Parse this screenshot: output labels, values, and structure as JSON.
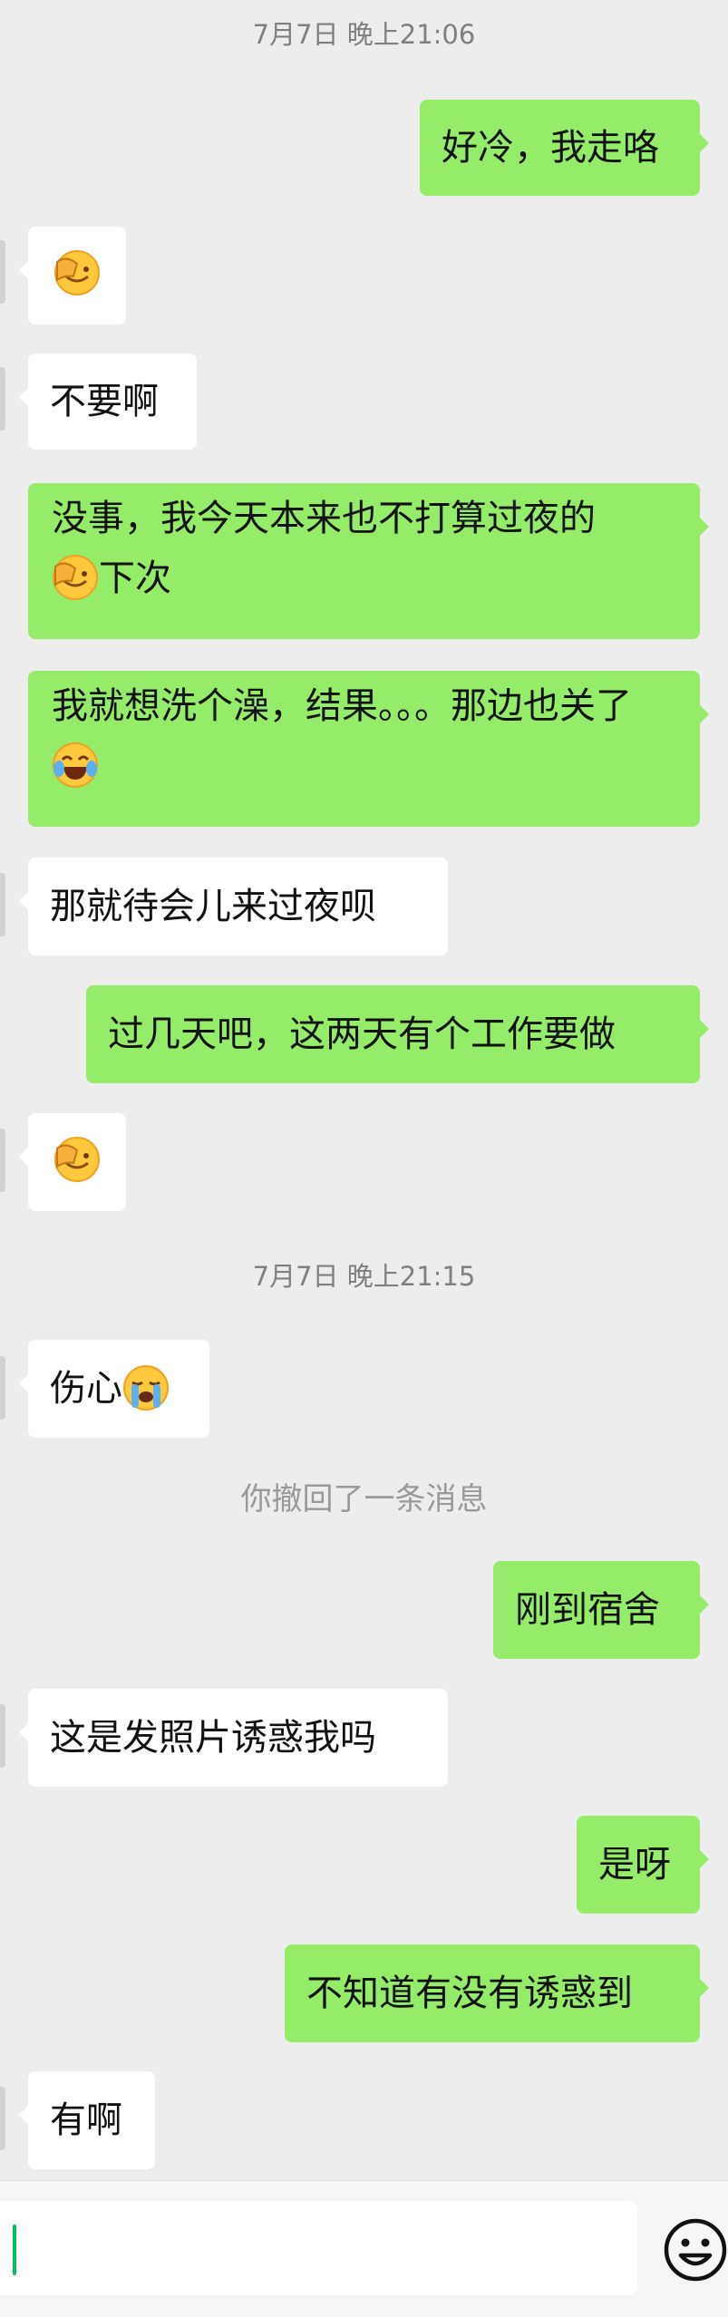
{
  "timestamps": [
    "7月7日 晚上21:06",
    "7月7日 晚上21:15"
  ],
  "system_message": "你撤回了一条消息",
  "messages": [
    {
      "side": "out",
      "text": "好冷，我走咯"
    },
    {
      "side": "in",
      "emoji": "facepalm"
    },
    {
      "side": "in",
      "text": "不要啊"
    },
    {
      "side": "out",
      "line1": "没事，我今天本来也不打算过夜的",
      "line2_after_emoji": "下次",
      "emoji": "facepalm"
    },
    {
      "side": "out",
      "line1": "我就想洗个澡，结果。。。那边也关了",
      "emoji": "tears-of-joy"
    },
    {
      "side": "in",
      "text": "那就待会儿来过夜呗"
    },
    {
      "side": "out",
      "text": "过几天吧，这两天有个工作要做"
    },
    {
      "side": "in",
      "emoji": "facepalm"
    },
    {
      "side": "in",
      "text": "伤心",
      "emoji": "crying"
    },
    {
      "side": "out",
      "text": "刚到宿舍"
    },
    {
      "side": "in",
      "text": "这是发照片诱惑我吗"
    },
    {
      "side": "out",
      "text": "是呀"
    },
    {
      "side": "out",
      "text": "不知道有没有诱惑到"
    },
    {
      "side": "in",
      "text": "有啊"
    }
  ],
  "input": {
    "value": "",
    "emoji_button_icon": "smiley-face-icon"
  },
  "colors": {
    "background": "#ededed",
    "outgoing_bubble": "#95ec69",
    "incoming_bubble": "#ffffff",
    "caret": "#07c160"
  }
}
